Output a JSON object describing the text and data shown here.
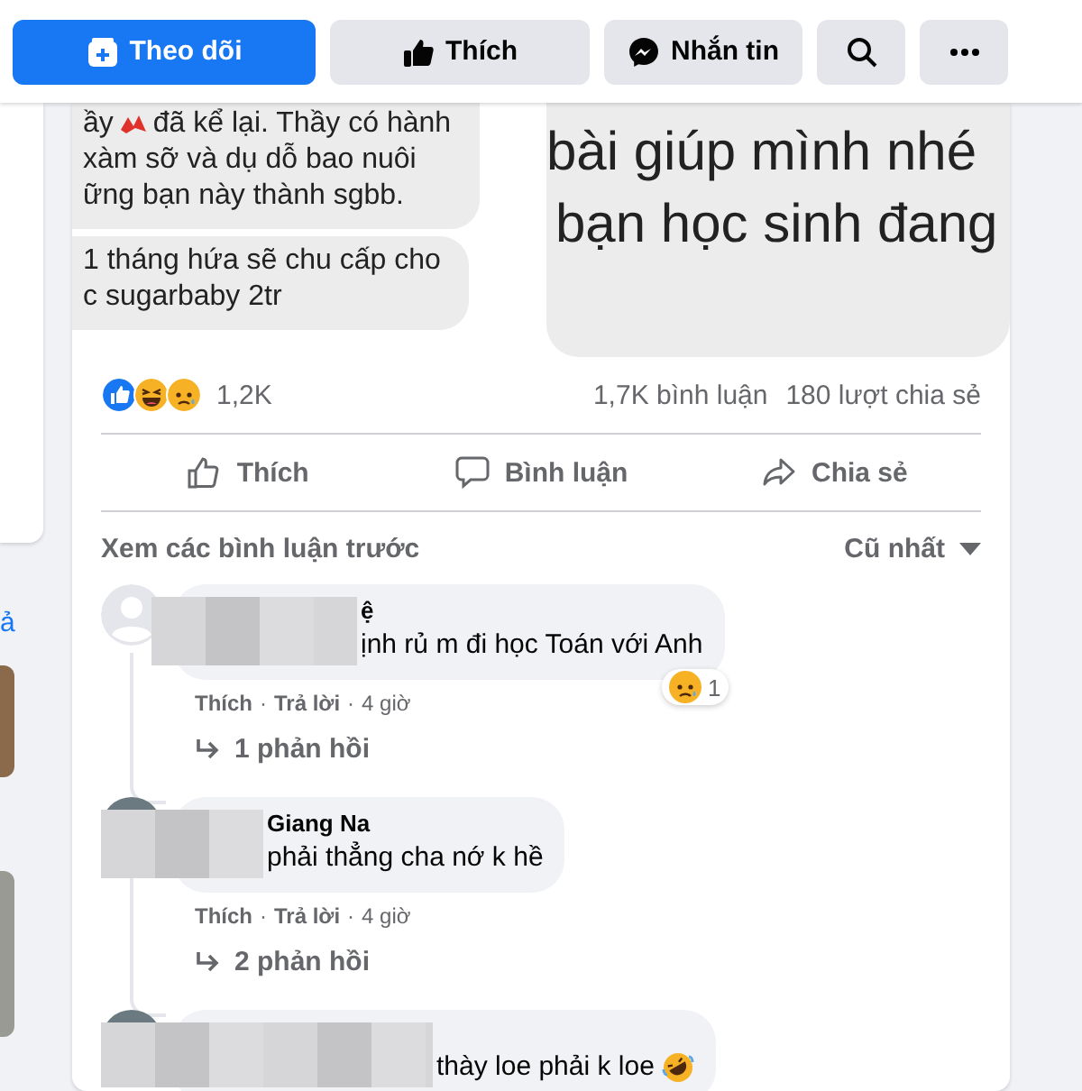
{
  "top_actions": [
    {
      "kind": "follow",
      "label": "Theo dõi",
      "primary": true
    },
    {
      "kind": "like",
      "label": "Thích",
      "primary": false
    },
    {
      "kind": "message",
      "label": "Nhắn tin",
      "primary": false
    },
    {
      "kind": "search",
      "primary": false
    },
    {
      "kind": "more",
      "primary": false
    }
  ],
  "sidebar": {
    "link_text": "ả"
  },
  "post": {
    "image": {
      "left_bubbles": [
        [
          [
            "ầy",
            "đã kể lại. Thầy có hành"
          ],
          [
            "xàm sỡ và dụ dỗ bao nuôi"
          ],
          [
            "ững bạn này thành sgbb."
          ]
        ],
        [
          [
            "1 tháng hứa sẽ chu cấp cho"
          ],
          [
            "c sugarbaby 2tr"
          ]
        ]
      ],
      "right_lines": [
        "bài giúp mình nhé",
        "bạn học sinh đang"
      ]
    },
    "reactions": {
      "types": [
        {
          "kind": "like"
        },
        {
          "kind": "haha"
        },
        {
          "kind": "sad"
        }
      ],
      "count": "1,2K"
    },
    "comment_count": "1,7K bình luận",
    "share_count": "180 lượt chia sẻ",
    "actions": [
      {
        "kind": "like",
        "label": "Thích"
      },
      {
        "kind": "comment",
        "label": "Bình luận"
      },
      {
        "kind": "share",
        "label": "Chia sẻ"
      }
    ],
    "previous_comments": "Xem các bình luận trước",
    "sort": "Cũ nhất",
    "comments": [
      {
        "avatar": {
          "kind": "default"
        },
        "name": "ệ",
        "text": "ịnh rủ m đi học Toán với Anh",
        "like": "Thích",
        "separator": "·",
        "reply": "Trả lời",
        "time": "4 giờ",
        "reaction": {
          "kind": "sad",
          "count": "1"
        },
        "replies": "1 phản hồi"
      },
      {
        "avatar": {
          "kind": "photo"
        },
        "name": "Giang Na",
        "text": "phải thẳng cha nớ k hề",
        "like": "Thích",
        "separator": "·",
        "reply": "Trả lời",
        "time": "4 giờ",
        "replies": "2 phản hồi"
      },
      {
        "avatar": {
          "kind": "photo"
        },
        "text": "thày loe phải k loe",
        "end_emoji": {
          "kind": "rofl"
        }
      }
    ]
  }
}
